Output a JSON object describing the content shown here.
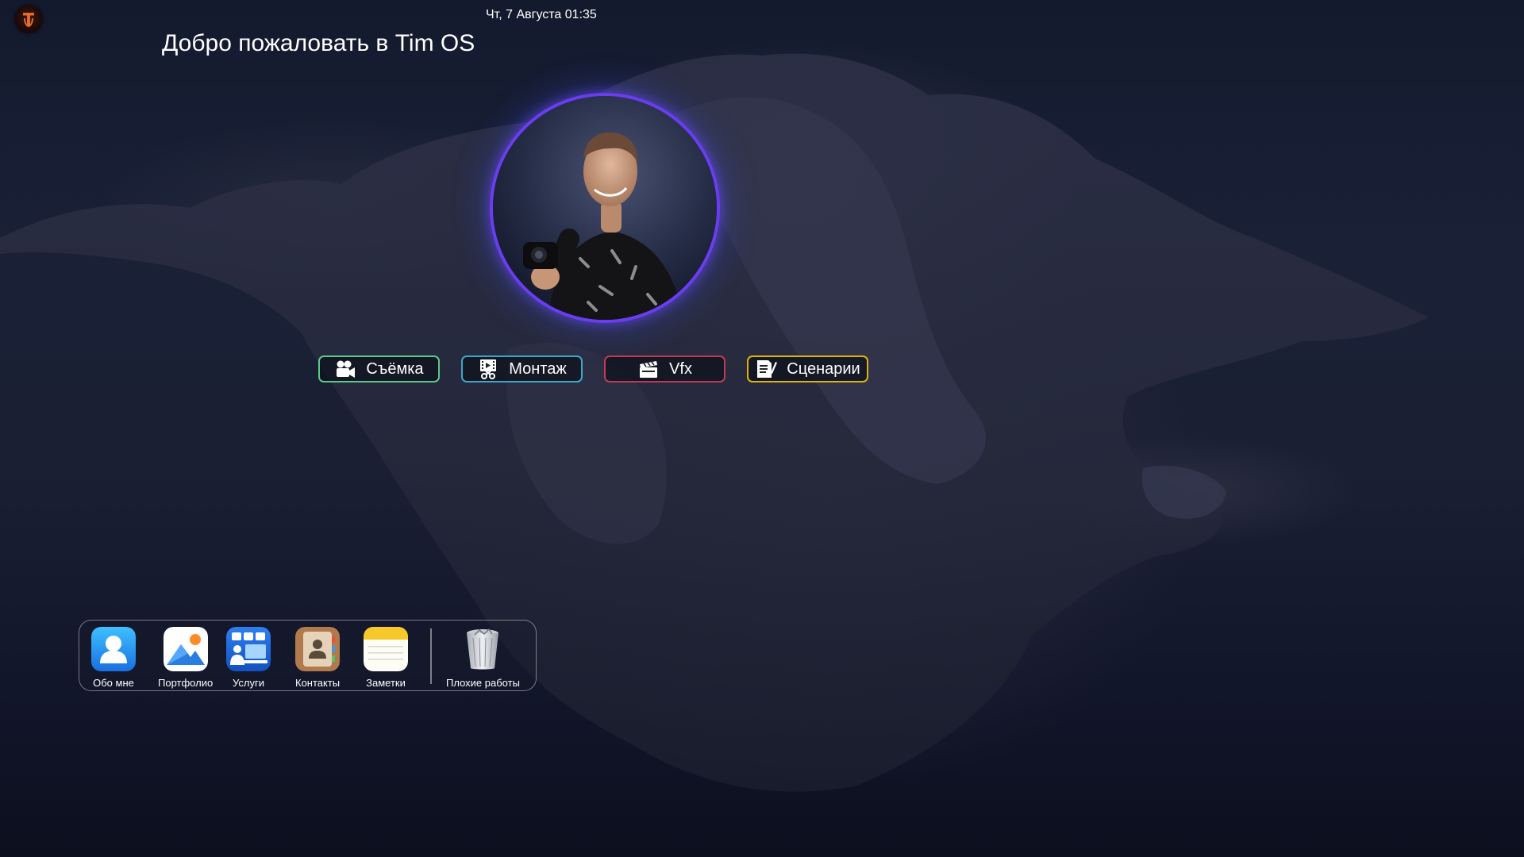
{
  "topbar": {
    "datetime": "Чт, 7 Августа 01:35",
    "logo_icon": "tim-os-logo-icon"
  },
  "welcome_title": "Добро пожаловать в Tim OS",
  "profile": {
    "avatar": "profile-photo",
    "ring_color": "#6a3df0"
  },
  "categories": [
    {
      "label": "Съёмка",
      "icon": "video-camera-icon",
      "border_color": "#5cc98c"
    },
    {
      "label": "Монтаж",
      "icon": "film-edit-icon",
      "border_color": "#3aa9c9"
    },
    {
      "label": "Vfx",
      "icon": "clapperboard-icon",
      "border_color": "#c03a55"
    },
    {
      "label": "Сценарии",
      "icon": "script-pen-icon",
      "border_color": "#e0b400"
    }
  ],
  "dock": {
    "apps": [
      {
        "label": "Обо мне",
        "icon": "user-icon"
      },
      {
        "label": "Портфолио",
        "icon": "photos-icon"
      },
      {
        "label": "Услуги",
        "icon": "services-icon"
      },
      {
        "label": "Контакты",
        "icon": "contacts-icon"
      },
      {
        "label": "Заметки",
        "icon": "notes-icon"
      }
    ],
    "trash": {
      "label": "Плохие работы",
      "icon": "trash-icon"
    }
  }
}
